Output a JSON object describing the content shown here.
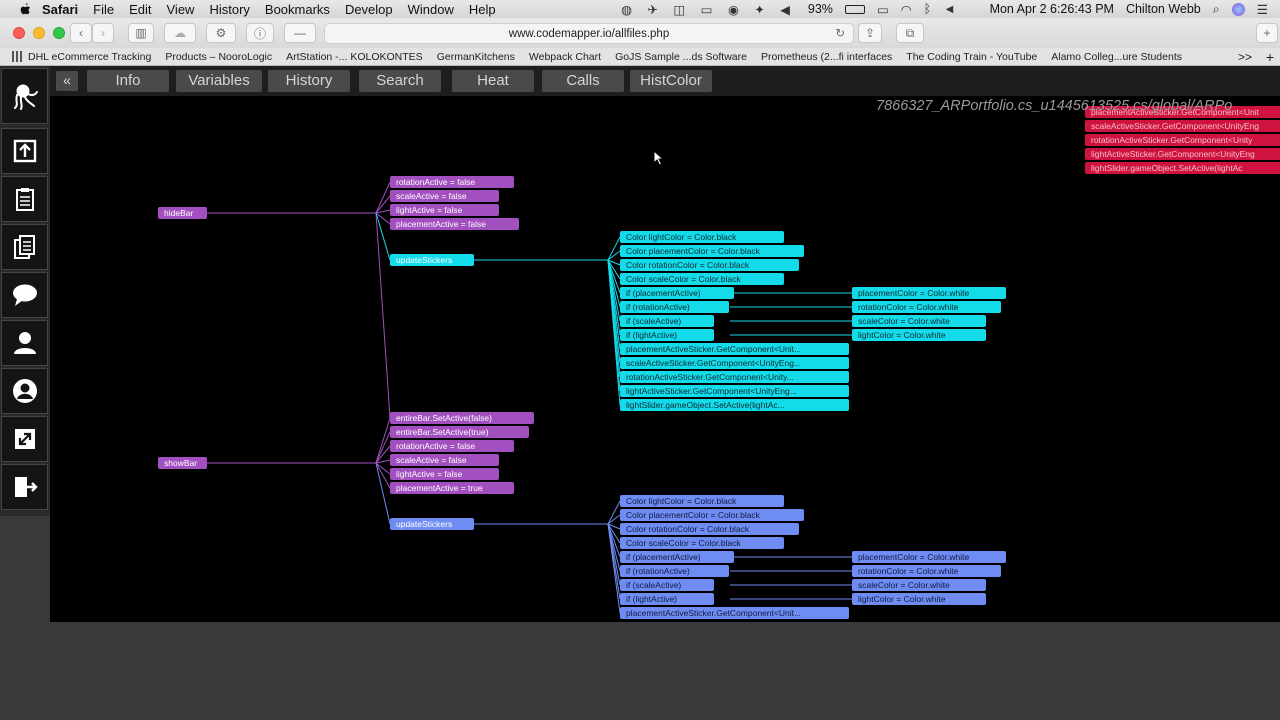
{
  "menubar": {
    "items": [
      "Safari",
      "File",
      "Edit",
      "View",
      "History",
      "Bookmarks",
      "Develop",
      "Window",
      "Help"
    ],
    "battery": "93%",
    "clock": "Mon Apr 2  6:26:43 PM",
    "user": "Chilton Webb"
  },
  "browser": {
    "url": "www.codemapper.io/allfiles.php",
    "bookmarks": [
      "DHL eCommerce Tracking",
      "Products – NooroLogic",
      "ArtStation -... KOLOKONTES",
      "GermanKitchens",
      "Webpack Chart",
      "GoJS Sample ...ds Software",
      "Prometheus (2...fi interfaces",
      "The Coding Train - YouTube",
      "Alamo Colleg...ure Students"
    ],
    "more": ">>"
  },
  "app": {
    "collapse": "«",
    "tabs": [
      "Info",
      "Variables",
      "History",
      "Search",
      "Heat",
      "Calls",
      "HistColor"
    ],
    "path": "7866327_ARPortfolio.cs_u1445613525.cs/global/ARPo"
  },
  "sidebar_icons": [
    "octopus-logo-icon",
    "upload-icon",
    "clipboard-icon",
    "documents-icon",
    "chat-bubble-icon",
    "person-icon",
    "profile-circle-icon",
    "resize-icon",
    "exit-icon"
  ],
  "colors": {
    "purple": "#a24fbf",
    "cyan": "#14dbea",
    "blue": "#6f8cf2",
    "red": "#d0123f"
  },
  "graph": {
    "roots": [
      {
        "name": "hideBar",
        "id": "hidebar"
      },
      {
        "name": "showBar",
        "id": "showbar"
      }
    ],
    "hidebar_children": [
      "rotationActive = false",
      "scaleActive = false",
      "lightActive = false",
      "placementActive = false"
    ],
    "update1": "updateStickers",
    "update1_children": [
      "Color lightColor = Color.black",
      "Color placementColor = Color.black",
      "Color rotationColor = Color.black",
      "Color scaleColor = Color.black",
      "if (placementActive)",
      "if (rotationActive)",
      "if (scaleActive)",
      "if (lightActive)",
      "placementActiveSticker.GetComponent<Unit...",
      "scaleActiveSticker.GetComponent<UnityEng...",
      "rotationActiveSticker.GetComponent<Unity...",
      "lightActiveSticker.GetComponent<UnityEng...",
      "lightSlider.gameObject.SetActive(lightAc..."
    ],
    "update1_leaves": [
      "placementColor = Color.white",
      "rotationColor = Color.white",
      "scaleColor = Color.white",
      "lightColor = Color.white"
    ],
    "showbar_children": [
      "entireBar.SetActive(false)",
      "entireBar.SetActive(true)",
      "rotationActive = false",
      "scaleActive = false",
      "lightActive = false",
      "placementActive = true"
    ],
    "update2": "updateStickers",
    "update2_children": [
      "Color lightColor = Color.black",
      "Color placementColor = Color.black",
      "Color rotationColor = Color.black",
      "Color scaleColor = Color.black",
      "if (placementActive)",
      "if (rotationActive)",
      "if (scaleActive)",
      "if (lightActive)",
      "placementActiveSticker.GetComponent<Unit..."
    ],
    "update2_leaves": [
      "placementColor = Color.white",
      "rotationColor = Color.white",
      "scaleColor = Color.white",
      "lightColor = Color.white"
    ],
    "red_nodes": [
      "placementActiveSticker.GetComponent<Unit",
      "scaleActiveSticker.GetComponent<UnityEng",
      "rotationActiveSticker.GetComponent<Unity",
      "lightActiveSticker.GetComponent<UnityEng",
      "lightSlider.gameObject.SetActive(lightAc"
    ]
  }
}
